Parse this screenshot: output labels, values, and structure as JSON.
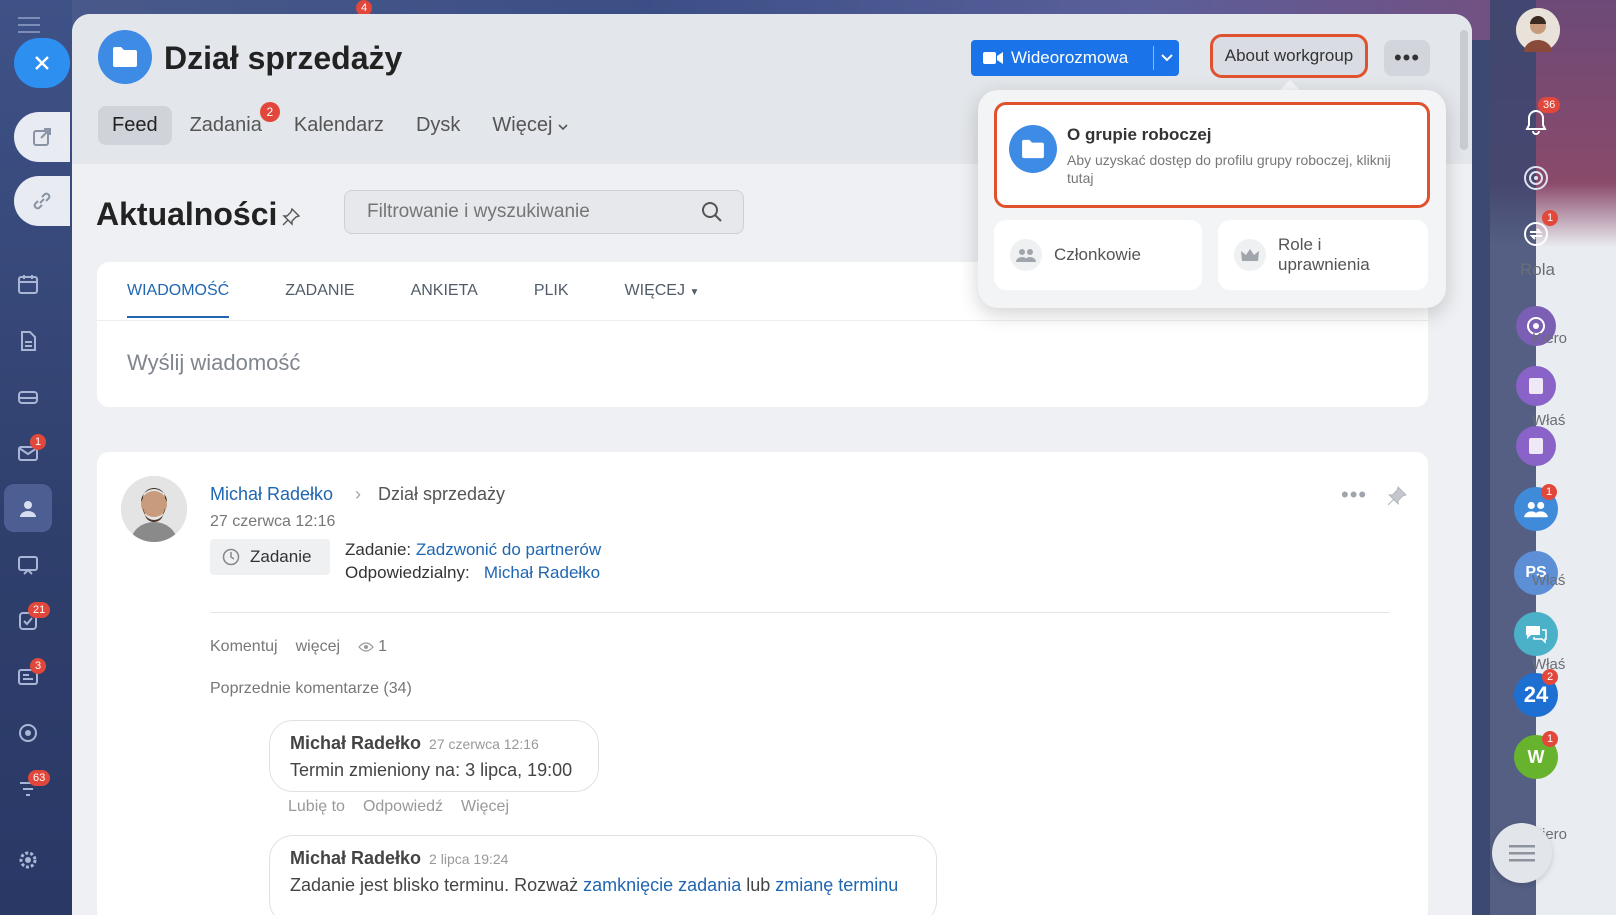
{
  "group": {
    "title": "Dział sprzedaży"
  },
  "header": {
    "video_button": "Wideorozmowa",
    "about_button": "About workgroup",
    "more_button": "•••"
  },
  "nav": {
    "items": [
      {
        "label": "Feed",
        "active": true
      },
      {
        "label": "Zadania",
        "badge": "2"
      },
      {
        "label": "Kalendarz"
      },
      {
        "label": "Dysk"
      },
      {
        "label": "Więcej"
      }
    ]
  },
  "feed": {
    "title": "Aktualności",
    "search_placeholder": "Filtrowanie i wyszukiwanie"
  },
  "composer": {
    "tabs": [
      "WIADOMOŚĆ",
      "ZADANIE",
      "ANKIETA",
      "PLIK",
      "WIĘCEJ"
    ],
    "placeholder": "Wyślij wiadomość"
  },
  "post": {
    "author": "Michał Radełko",
    "target": "Dział sprzedaży",
    "date": "27 czerwca 12:16",
    "tag": "Zadanie",
    "task_prefix": "Zadanie:",
    "task_link": "Zadzwonić do partnerów",
    "responsible_label": "Odpowiedzialny:",
    "responsible_name": "Michał Radełko",
    "actions": {
      "comment": "Komentuj",
      "more": "więcej",
      "views": "1"
    },
    "previous_comments": "Poprzednie komentarze (34)",
    "comments": [
      {
        "author": "Michał Radełko",
        "date": "27 czerwca 12:16",
        "text": "Termin zmieniony na: 3 lipca, 19:00",
        "actions": [
          "Lubię to",
          "Odpowiedź",
          "Więcej"
        ]
      },
      {
        "author": "Michał Radełko",
        "date": "2 lipca 19:24",
        "text_before": "Zadanie jest blisko terminu. Rozważ ",
        "link1": "zamknięcie zadania",
        "text_mid": " lub ",
        "link2": "zmianę terminu"
      }
    ]
  },
  "popup": {
    "main_title": "O grupie roboczej",
    "main_desc": "Aby uzyskać dostęp do profilu grupy roboczej, kliknij tutaj",
    "members": "Członkowie",
    "roles": "Role i uprawnienia"
  },
  "left_sidebar": {
    "badges": {
      "mail": "1",
      "tasks": "21",
      "news": "3",
      "filter": "63",
      "top": "4"
    }
  },
  "right_rail": {
    "badges": {
      "notifications": "36",
      "sync": "1",
      "group": "1",
      "b24": "2",
      "w": "1"
    },
    "avatar_ps": "PS",
    "avatar_w": "W",
    "b24_label": "24",
    "text_rola": "Rola",
    "text_wlas1": "Właś",
    "text_wlas2": "Właś",
    "text_wlas3": "Właś",
    "text_kiero1": "Kiero",
    "text_kiero2": "Kiero"
  },
  "colors": {
    "accent": "#1a73e8",
    "link": "#2066b0",
    "highlight": "#e0522d",
    "badge": "#e1483b"
  }
}
